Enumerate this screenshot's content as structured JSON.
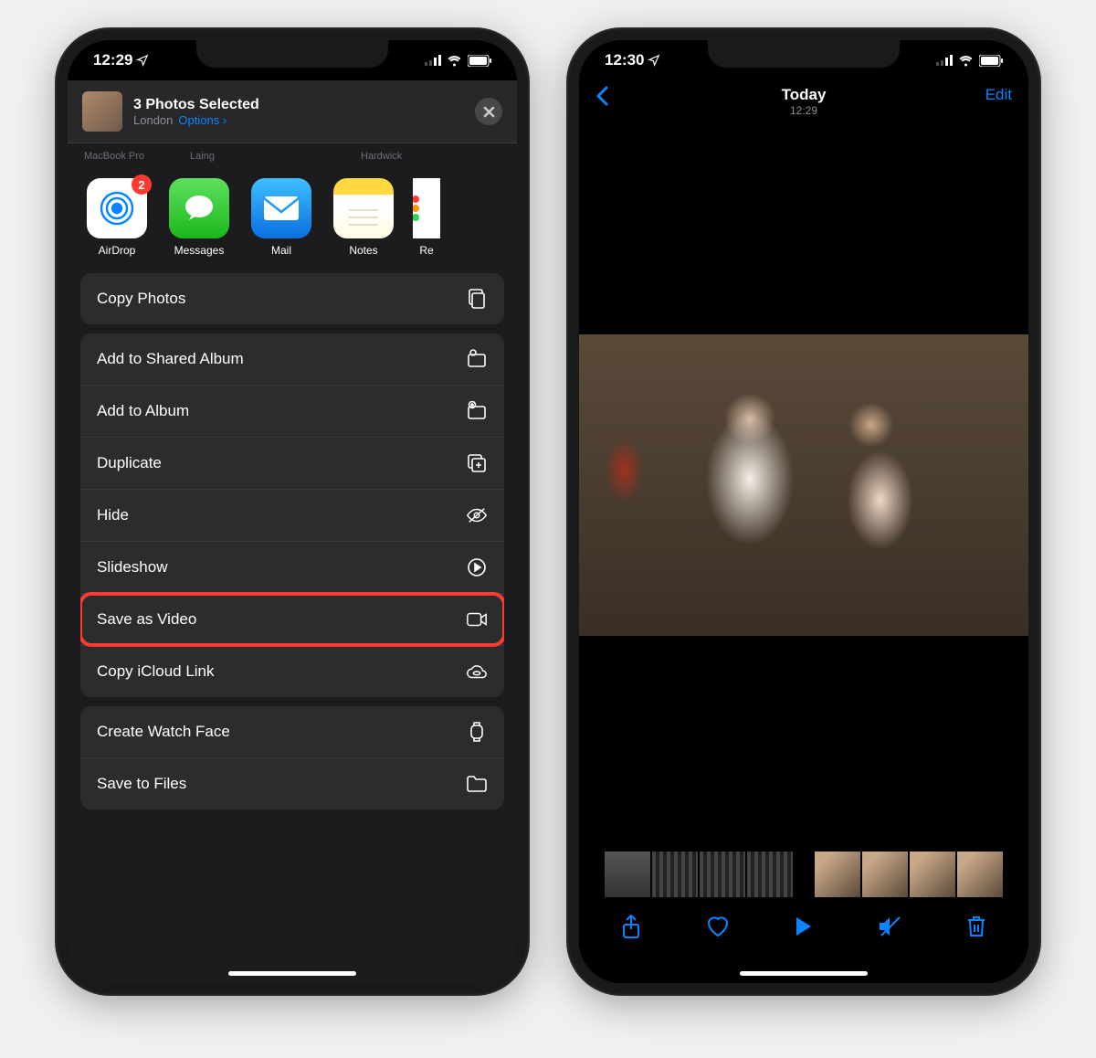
{
  "left": {
    "status_time": "12:29",
    "sheet": {
      "title": "3 Photos Selected",
      "location": "London",
      "options_label": "Options",
      "airdrop_devices": [
        "MacBook Pro",
        "Laing",
        "Hardwick"
      ],
      "apps": [
        {
          "name": "AirDrop",
          "badge": "2",
          "color": "#fff",
          "icon": "airdrop"
        },
        {
          "name": "Messages",
          "color": "#30d158",
          "icon": "message"
        },
        {
          "name": "Mail",
          "color": "#1e9bf0",
          "icon": "mail"
        },
        {
          "name": "Notes",
          "color": "#fffde6",
          "icon": "notes"
        },
        {
          "name": "Re",
          "color": "#fff",
          "icon": "reminders"
        }
      ],
      "groups": [
        [
          {
            "label": "Copy Photos",
            "icon": "copy"
          }
        ],
        [
          {
            "label": "Add to Shared Album",
            "icon": "shared-album"
          },
          {
            "label": "Add to Album",
            "icon": "album-add"
          },
          {
            "label": "Duplicate",
            "icon": "duplicate"
          },
          {
            "label": "Hide",
            "icon": "hide"
          },
          {
            "label": "Slideshow",
            "icon": "play-circle"
          },
          {
            "label": "Save as Video",
            "icon": "video",
            "highlight": true
          },
          {
            "label": "Copy iCloud Link",
            "icon": "cloud-link"
          }
        ],
        [
          {
            "label": "Create Watch Face",
            "icon": "watch"
          },
          {
            "label": "Save to Files",
            "icon": "folder"
          }
        ]
      ]
    }
  },
  "right": {
    "status_time": "12:30",
    "nav": {
      "title": "Today",
      "subtitle": "12:29",
      "edit": "Edit"
    }
  }
}
